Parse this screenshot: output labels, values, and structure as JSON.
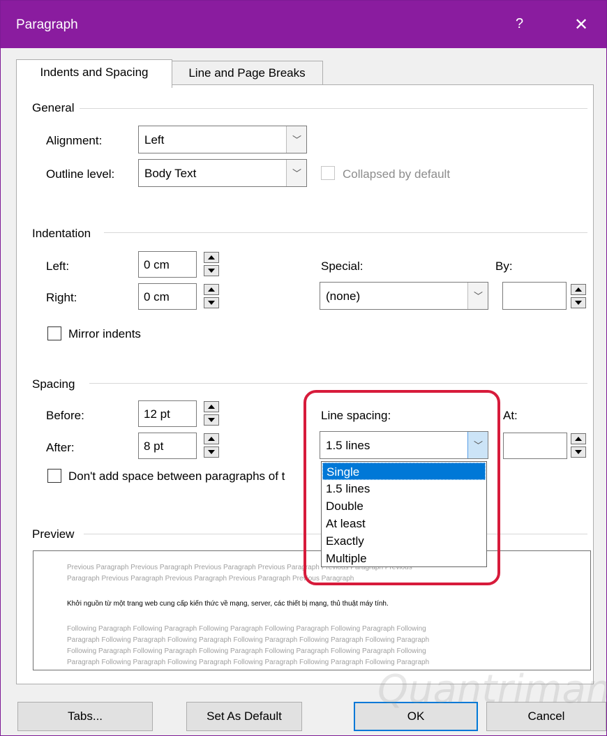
{
  "window": {
    "title": "Paragraph",
    "help": "?",
    "close": "✕"
  },
  "tabs": {
    "indents_spacing": "Indents and Spacing",
    "line_page_breaks": "Line and Page Breaks"
  },
  "general": {
    "heading": "General",
    "alignment_label": "Alignment:",
    "alignment_value": "Left",
    "outline_label": "Outline level:",
    "outline_value": "Body Text",
    "collapsed_label": "Collapsed by default"
  },
  "indentation": {
    "heading": "Indentation",
    "left_label": "Left:",
    "left_value": "0 cm",
    "right_label": "Right:",
    "right_value": "0 cm",
    "special_label": "Special:",
    "special_value": "(none)",
    "by_label": "By:",
    "by_value": "",
    "mirror_label": "Mirror indents"
  },
  "spacing": {
    "heading": "Spacing",
    "before_label": "Before:",
    "before_value": "12 pt",
    "after_label": "After:",
    "after_value": "8 pt",
    "line_spacing_label": "Line spacing:",
    "line_spacing_value": "1.5 lines",
    "at_label": "At:",
    "at_value": "",
    "dont_add_label": "Don't add space between paragraphs of t"
  },
  "line_spacing_options": [
    "Single",
    "1.5 lines",
    "Double",
    "At least",
    "Exactly",
    "Multiple"
  ],
  "preview": {
    "heading": "Preview",
    "previous_1": "Previous Paragraph Previous Paragraph Previous Paragraph Previous Paragraph Previous Paragraph Previous",
    "previous_2": "Paragraph Previous Paragraph Previous Paragraph Previous Paragraph Previous Paragraph",
    "sample": "Khởi nguồn từ một trang web cung cấp kiến thức về mạng, server, các thiết bị mạng, thủ thuật máy tính.",
    "following_1": "Following Paragraph Following Paragraph Following Paragraph Following Paragraph Following Paragraph Following",
    "following_2": "Paragraph Following Paragraph Following Paragraph Following Paragraph Following Paragraph Following Paragraph",
    "following_3": "Following Paragraph Following Paragraph Following Paragraph Following Paragraph Following Paragraph Following",
    "following_4": "Paragraph Following Paragraph Following Paragraph Following Paragraph Following Paragraph Following Paragraph"
  },
  "buttons": {
    "tabs": "Tabs...",
    "set_default": "Set As Default",
    "ok": "OK",
    "cancel": "Cancel"
  },
  "watermark": "Quantrimang",
  "colors": {
    "titlebar": "#8a1c9f",
    "highlight": "#d71b3b",
    "selection": "#0078d7"
  }
}
